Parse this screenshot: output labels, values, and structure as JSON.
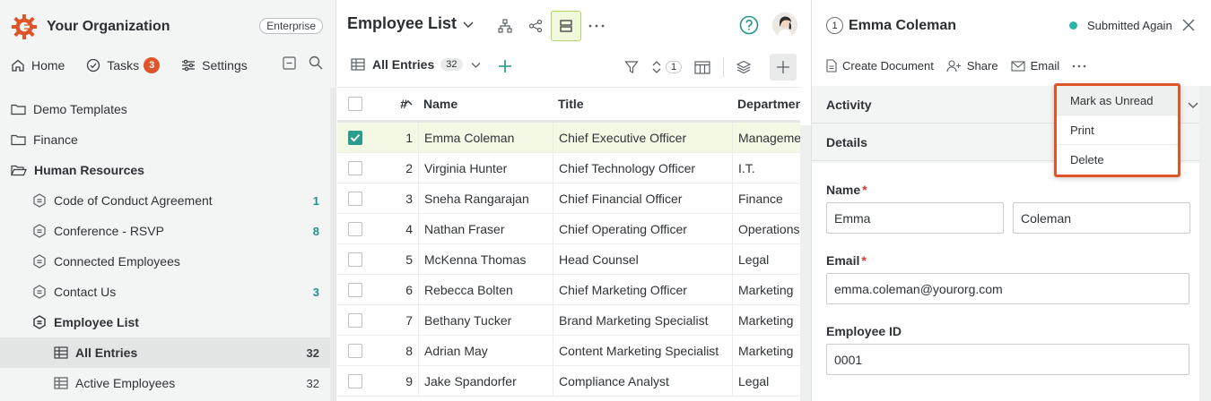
{
  "sidebar": {
    "org_name": "Your Organization",
    "plan": "Enterprise",
    "nav": {
      "home": "Home",
      "tasks": "Tasks",
      "tasks_count": "3",
      "settings": "Settings"
    },
    "tree": [
      {
        "label": "Demo Templates",
        "count": ""
      },
      {
        "label": "Finance",
        "count": ""
      },
      {
        "label": "Human Resources",
        "count": ""
      },
      {
        "label": "Code of Conduct Agreement",
        "count": "1"
      },
      {
        "label": "Conference - RSVP",
        "count": "8"
      },
      {
        "label": "Connected Employees",
        "count": ""
      },
      {
        "label": "Contact Us",
        "count": "3"
      },
      {
        "label": "Employee List",
        "count": ""
      },
      {
        "label": "All Entries",
        "count": "32"
      },
      {
        "label": "Active Employees",
        "count": "32"
      }
    ]
  },
  "main": {
    "title": "Employee List",
    "entries_label": "All Entries",
    "entries_count": "32",
    "sort_count": "1",
    "columns": {
      "num": "#",
      "name": "Name",
      "title": "Title",
      "dept": "Department"
    },
    "rows": [
      {
        "num": "1",
        "name": "Emma Coleman",
        "title": "Chief Executive Officer",
        "dept": "Management"
      },
      {
        "num": "2",
        "name": "Virginia Hunter",
        "title": "Chief Technology Officer",
        "dept": "I.T."
      },
      {
        "num": "3",
        "name": "Sneha Rangarajan",
        "title": "Chief Financial Officer",
        "dept": "Finance"
      },
      {
        "num": "4",
        "name": "Nathan Fraser",
        "title": "Chief Operating Officer",
        "dept": "Operations"
      },
      {
        "num": "5",
        "name": "McKenna Thomas",
        "title": "Head Counsel",
        "dept": "Legal"
      },
      {
        "num": "6",
        "name": "Rebecca Bolten",
        "title": "Chief Marketing Officer",
        "dept": "Marketing"
      },
      {
        "num": "7",
        "name": "Bethany Tucker",
        "title": "Brand Marketing Specialist",
        "dept": "Marketing"
      },
      {
        "num": "8",
        "name": "Adrian May",
        "title": "Content Marketing Specialist",
        "dept": "Marketing"
      },
      {
        "num": "9",
        "name": "Jake Spandorfer",
        "title": "Compliance Analyst",
        "dept": "Legal"
      }
    ]
  },
  "detail": {
    "record_number": "1",
    "record_name": "Emma Coleman",
    "status": "Submitted Again",
    "actions": {
      "create_doc": "Create Document",
      "share": "Share",
      "email": "Email"
    },
    "sections": {
      "activity": "Activity",
      "details": "Details"
    },
    "fields": {
      "name_label": "Name",
      "first_name": "Emma",
      "last_name": "Coleman",
      "email_label": "Email",
      "email": "emma.coleman@yourorg.com",
      "employee_id_label": "Employee ID",
      "employee_id": "0001"
    },
    "required_mark": "*"
  },
  "menu": {
    "items": [
      "Mark as Unread",
      "Print",
      "Delete"
    ]
  },
  "colors": {
    "brand": "#e0542a",
    "accent": "#2a9d8f",
    "status_dot": "#2bb3a3",
    "selected_row": "#f4f9e6"
  }
}
